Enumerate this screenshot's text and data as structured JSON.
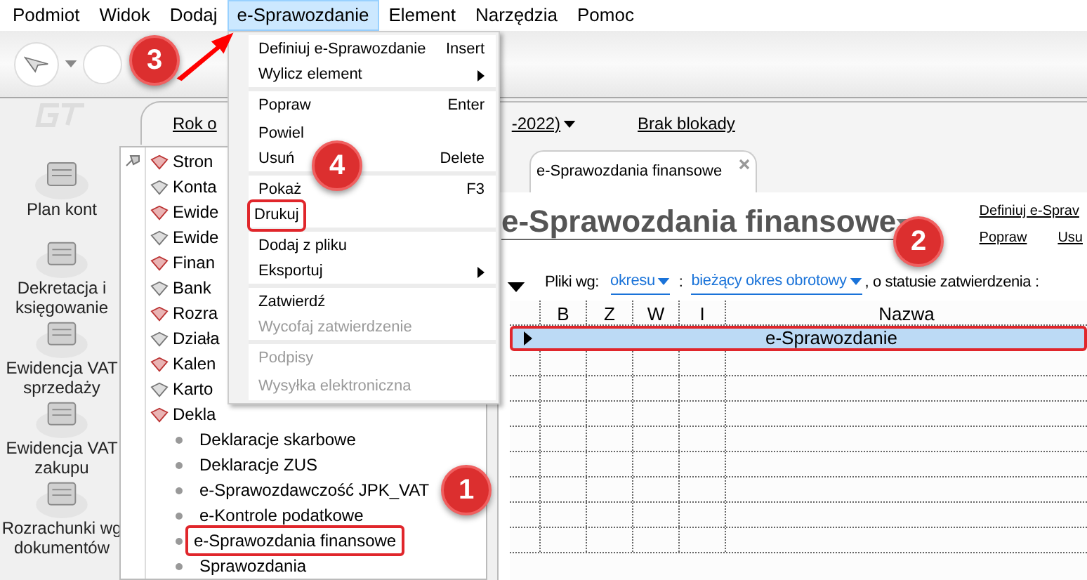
{
  "menu_bar": [
    {
      "label": "Podmiot",
      "selected": false
    },
    {
      "label": "Widok",
      "selected": false
    },
    {
      "label": "Dodaj",
      "selected": false
    },
    {
      "label": "e-Sprawozdanie",
      "selected": true
    },
    {
      "label": "Element",
      "selected": false
    },
    {
      "label": "Narzędzia",
      "selected": false
    },
    {
      "label": "Pomoc",
      "selected": false
    }
  ],
  "dropdown": {
    "items": [
      {
        "label": "Definiuj e-Sprawozdanie",
        "shortcut": "Insert",
        "disabled": false,
        "submenu": false,
        "separator_after": false,
        "framed": false
      },
      {
        "label": "Wylicz element",
        "disabled": false,
        "submenu": true,
        "separator_after": true,
        "framed": false
      },
      {
        "label": "Popraw",
        "shortcut": "Enter",
        "disabled": false,
        "submenu": false,
        "separator_after": false,
        "framed": false
      },
      {
        "label": "Powiel",
        "disabled": false,
        "submenu": false,
        "separator_after": false,
        "framed": false
      },
      {
        "label": "Usuń",
        "shortcut": "Delete",
        "disabled": false,
        "submenu": false,
        "separator_after": true,
        "framed": false
      },
      {
        "label": "Pokaż",
        "shortcut": "F3",
        "disabled": false,
        "submenu": false,
        "separator_after": false,
        "framed": false
      },
      {
        "label": "Drukuj",
        "disabled": false,
        "submenu": false,
        "separator_after": true,
        "framed": true
      },
      {
        "label": "Dodaj z pliku",
        "disabled": false,
        "submenu": false,
        "separator_after": false,
        "framed": false
      },
      {
        "label": "Eksportuj",
        "disabled": false,
        "submenu": true,
        "separator_after": true,
        "framed": false
      },
      {
        "label": "Zatwierdź",
        "disabled": false,
        "submenu": false,
        "separator_after": false,
        "framed": false
      },
      {
        "label": "Wycofaj zatwierdzenie",
        "disabled": true,
        "submenu": false,
        "separator_after": true,
        "framed": false
      },
      {
        "label": "Podpisy",
        "disabled": true,
        "submenu": false,
        "separator_after": false,
        "framed": false
      },
      {
        "label": "Wysyłka elektroniczna",
        "disabled": true,
        "submenu": false,
        "separator_after": false,
        "framed": false
      }
    ]
  },
  "sidebar": {
    "items": [
      {
        "label": "Plan kont"
      },
      {
        "label": "Dekretacja i księgowanie"
      },
      {
        "label": "Ewidencja VAT sprzedaży"
      },
      {
        "label": "Ewidencja VAT zakupu"
      },
      {
        "label": "Rozrachunki wg dokumentów"
      }
    ]
  },
  "top_bar": {
    "period_start": "Rok o",
    "period_end": "-2022)",
    "lock_status": "Brak blokady"
  },
  "tree": {
    "items": [
      {
        "label": "Stron"
      },
      {
        "label": "Konta"
      },
      {
        "label": "Ewide"
      },
      {
        "label": "Ewide"
      },
      {
        "label": "Finan"
      },
      {
        "label": "Bank"
      },
      {
        "label": "Rozra"
      },
      {
        "label": "Działa"
      },
      {
        "label": "Kalen"
      },
      {
        "label": "Karto"
      },
      {
        "label": "Dekla",
        "children": [
          {
            "label": "Deklaracje skarbowe",
            "framed": false
          },
          {
            "label": "Deklaracje ZUS",
            "framed": false
          },
          {
            "label": "e-Sprawozdawczość JPK_VAT",
            "framed": false
          },
          {
            "label": "e-Kontrole podatkowe",
            "framed": false
          },
          {
            "label": "e-Sprawozdania finansowe",
            "framed": true
          },
          {
            "label": "Sprawozdania",
            "framed": false
          }
        ]
      }
    ]
  },
  "tab": {
    "label": "e-Sprawozdania finansowe"
  },
  "page_title": "e-Sprawozdania finansowe",
  "actions": [
    "Definiuj e-Sprav",
    "Popraw",
    "Usu"
  ],
  "filter": {
    "label": "Pliki wg:",
    "by": "okresu",
    "colon": ":",
    "period": "bieżący okres obrotowy",
    "status_label": ", o statusie zatwierdzenia :"
  },
  "table": {
    "columns": [
      "B",
      "Z",
      "W",
      "I",
      "Nazwa"
    ],
    "rows": [
      {
        "name": "e-Sprawozdanie",
        "selected": true,
        "framed": true
      }
    ]
  },
  "annotations": [
    {
      "number": "3"
    },
    {
      "number": "4"
    },
    {
      "number": "1"
    },
    {
      "number": "2"
    }
  ]
}
